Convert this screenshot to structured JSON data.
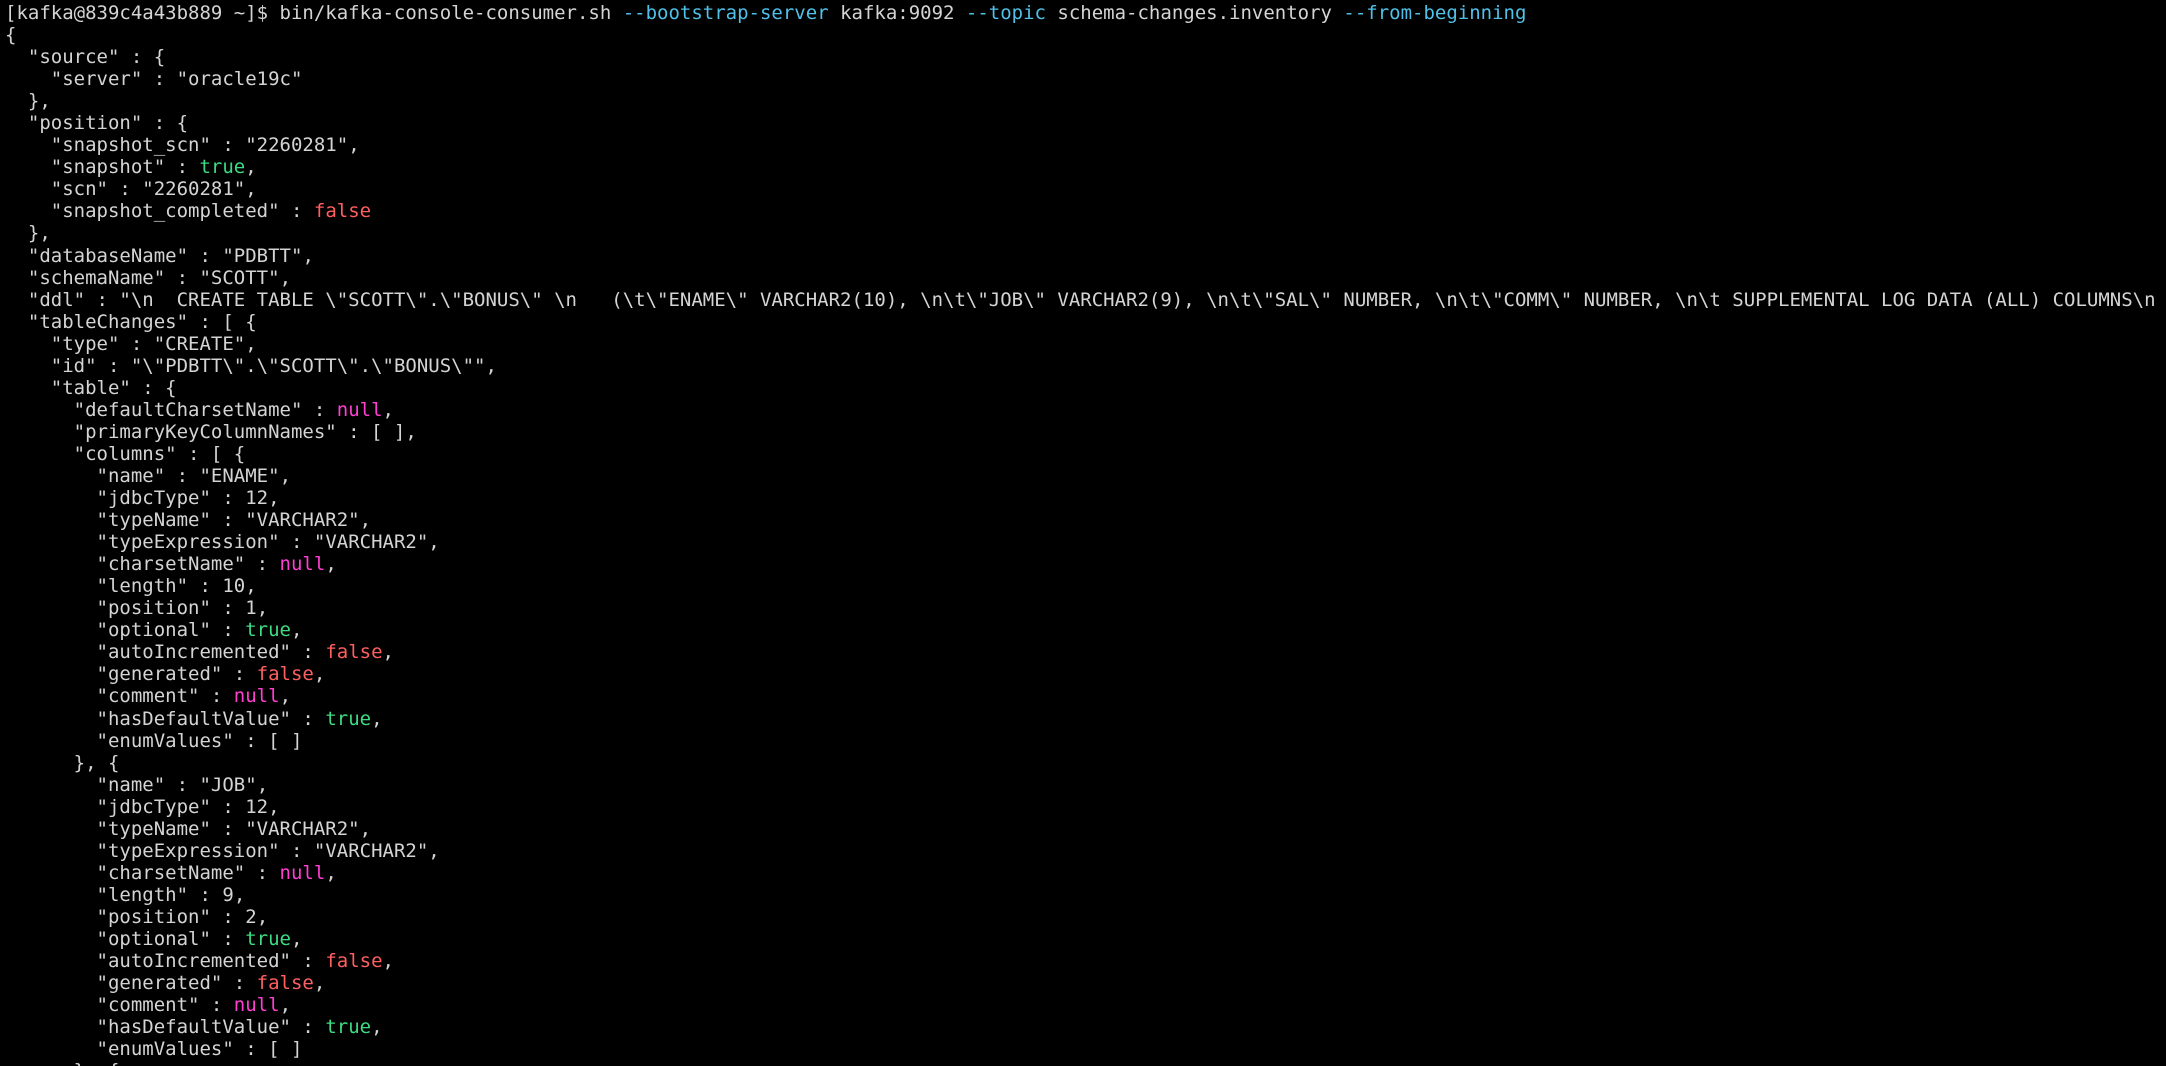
{
  "colors": {
    "background": "#000000",
    "text": "#d4d4d4",
    "flag": "#4fc1e9",
    "true": "#3ddc84",
    "false": "#ff5f5f",
    "null": "#ff3fd2"
  },
  "terminal": {
    "lines": [
      [
        [
          "prompt",
          "[kafka@839c4a43b889 ~]$ "
        ],
        [
          "cmd",
          "bin/kafka-console-consumer.sh "
        ],
        [
          "flag",
          "--bootstrap-server"
        ],
        [
          "arg",
          " kafka:9092 "
        ],
        [
          "flag",
          "--topic"
        ],
        [
          "arg",
          " schema-changes.inventory "
        ],
        [
          "flag",
          "--from-beginning"
        ]
      ],
      [
        [
          "punct",
          "{"
        ]
      ],
      [
        [
          "key",
          "  \"source\""
        ],
        [
          "punct",
          " : {"
        ]
      ],
      [
        [
          "key",
          "    \"server\""
        ],
        [
          "punct",
          " : "
        ],
        [
          "str",
          "\"oracle19c\""
        ]
      ],
      [
        [
          "punct",
          "  },"
        ]
      ],
      [
        [
          "key",
          "  \"position\""
        ],
        [
          "punct",
          " : {"
        ]
      ],
      [
        [
          "key",
          "    \"snapshot_scn\""
        ],
        [
          "punct",
          " : "
        ],
        [
          "str",
          "\"2260281\""
        ],
        [
          "punct",
          ","
        ]
      ],
      [
        [
          "key",
          "    \"snapshot\""
        ],
        [
          "punct",
          " : "
        ],
        [
          "true",
          "true"
        ],
        [
          "punct",
          ","
        ]
      ],
      [
        [
          "key",
          "    \"scn\""
        ],
        [
          "punct",
          " : "
        ],
        [
          "str",
          "\"2260281\""
        ],
        [
          "punct",
          ","
        ]
      ],
      [
        [
          "key",
          "    \"snapshot_completed\""
        ],
        [
          "punct",
          " : "
        ],
        [
          "false",
          "false"
        ]
      ],
      [
        [
          "punct",
          "  },"
        ]
      ],
      [
        [
          "key",
          "  \"databaseName\""
        ],
        [
          "punct",
          " : "
        ],
        [
          "str",
          "\"PDBTT\""
        ],
        [
          "punct",
          ","
        ]
      ],
      [
        [
          "key",
          "  \"schemaName\""
        ],
        [
          "punct",
          " : "
        ],
        [
          "str",
          "\"SCOTT\""
        ],
        [
          "punct",
          ","
        ]
      ],
      [
        [
          "key",
          "  \"ddl\""
        ],
        [
          "punct",
          " : "
        ],
        [
          "str",
          "\"\\n  CREATE TABLE \\\"SCOTT\\\".\\\"BONUS\\\" \\n   (\\t\\\"ENAME\\\" VARCHAR2(10), \\n\\t\\\"JOB\\\" VARCHAR2(9), \\n\\t\\\"SAL\\\" NUMBER, \\n\\t\\\"COMM\\\" NUMBER, \\n\\t SUPPLEMENTAL LOG DATA (ALL) COLUMNS\\n   ) ;\""
        ],
        [
          "punct",
          ","
        ]
      ],
      [
        [
          "key",
          "  \"tableChanges\""
        ],
        [
          "punct",
          " : [ {"
        ]
      ],
      [
        [
          "key",
          "    \"type\""
        ],
        [
          "punct",
          " : "
        ],
        [
          "str",
          "\"CREATE\""
        ],
        [
          "punct",
          ","
        ]
      ],
      [
        [
          "key",
          "    \"id\""
        ],
        [
          "punct",
          " : "
        ],
        [
          "str",
          "\"\\\"PDBTT\\\".\\\"SCOTT\\\".\\\"BONUS\\\"\""
        ],
        [
          "punct",
          ","
        ]
      ],
      [
        [
          "key",
          "    \"table\""
        ],
        [
          "punct",
          " : {"
        ]
      ],
      [
        [
          "key",
          "      \"defaultCharsetName\""
        ],
        [
          "punct",
          " : "
        ],
        [
          "null",
          "null"
        ],
        [
          "punct",
          ","
        ]
      ],
      [
        [
          "key",
          "      \"primaryKeyColumnNames\""
        ],
        [
          "punct",
          " : [ ],"
        ]
      ],
      [
        [
          "key",
          "      \"columns\""
        ],
        [
          "punct",
          " : [ {"
        ]
      ],
      [
        [
          "key",
          "        \"name\""
        ],
        [
          "punct",
          " : "
        ],
        [
          "str",
          "\"ENAME\""
        ],
        [
          "punct",
          ","
        ]
      ],
      [
        [
          "key",
          "        \"jdbcType\""
        ],
        [
          "punct",
          " : "
        ],
        [
          "num",
          "12"
        ],
        [
          "punct",
          ","
        ]
      ],
      [
        [
          "key",
          "        \"typeName\""
        ],
        [
          "punct",
          " : "
        ],
        [
          "str",
          "\"VARCHAR2\""
        ],
        [
          "punct",
          ","
        ]
      ],
      [
        [
          "key",
          "        \"typeExpression\""
        ],
        [
          "punct",
          " : "
        ],
        [
          "str",
          "\"VARCHAR2\""
        ],
        [
          "punct",
          ","
        ]
      ],
      [
        [
          "key",
          "        \"charsetName\""
        ],
        [
          "punct",
          " : "
        ],
        [
          "null",
          "null"
        ],
        [
          "punct",
          ","
        ]
      ],
      [
        [
          "key",
          "        \"length\""
        ],
        [
          "punct",
          " : "
        ],
        [
          "num",
          "10"
        ],
        [
          "punct",
          ","
        ]
      ],
      [
        [
          "key",
          "        \"position\""
        ],
        [
          "punct",
          " : "
        ],
        [
          "num",
          "1"
        ],
        [
          "punct",
          ","
        ]
      ],
      [
        [
          "key",
          "        \"optional\""
        ],
        [
          "punct",
          " : "
        ],
        [
          "true",
          "true"
        ],
        [
          "punct",
          ","
        ]
      ],
      [
        [
          "key",
          "        \"autoIncremented\""
        ],
        [
          "punct",
          " : "
        ],
        [
          "false",
          "false"
        ],
        [
          "punct",
          ","
        ]
      ],
      [
        [
          "key",
          "        \"generated\""
        ],
        [
          "punct",
          " : "
        ],
        [
          "false",
          "false"
        ],
        [
          "punct",
          ","
        ]
      ],
      [
        [
          "key",
          "        \"comment\""
        ],
        [
          "punct",
          " : "
        ],
        [
          "null",
          "null"
        ],
        [
          "punct",
          ","
        ]
      ],
      [
        [
          "key",
          "        \"hasDefaultValue\""
        ],
        [
          "punct",
          " : "
        ],
        [
          "true",
          "true"
        ],
        [
          "punct",
          ","
        ]
      ],
      [
        [
          "key",
          "        \"enumValues\""
        ],
        [
          "punct",
          " : [ ]"
        ]
      ],
      [
        [
          "punct",
          "      }, {"
        ]
      ],
      [
        [
          "key",
          "        \"name\""
        ],
        [
          "punct",
          " : "
        ],
        [
          "str",
          "\"JOB\""
        ],
        [
          "punct",
          ","
        ]
      ],
      [
        [
          "key",
          "        \"jdbcType\""
        ],
        [
          "punct",
          " : "
        ],
        [
          "num",
          "12"
        ],
        [
          "punct",
          ","
        ]
      ],
      [
        [
          "key",
          "        \"typeName\""
        ],
        [
          "punct",
          " : "
        ],
        [
          "str",
          "\"VARCHAR2\""
        ],
        [
          "punct",
          ","
        ]
      ],
      [
        [
          "key",
          "        \"typeExpression\""
        ],
        [
          "punct",
          " : "
        ],
        [
          "str",
          "\"VARCHAR2\""
        ],
        [
          "punct",
          ","
        ]
      ],
      [
        [
          "key",
          "        \"charsetName\""
        ],
        [
          "punct",
          " : "
        ],
        [
          "null",
          "null"
        ],
        [
          "punct",
          ","
        ]
      ],
      [
        [
          "key",
          "        \"length\""
        ],
        [
          "punct",
          " : "
        ],
        [
          "num",
          "9"
        ],
        [
          "punct",
          ","
        ]
      ],
      [
        [
          "key",
          "        \"position\""
        ],
        [
          "punct",
          " : "
        ],
        [
          "num",
          "2"
        ],
        [
          "punct",
          ","
        ]
      ],
      [
        [
          "key",
          "        \"optional\""
        ],
        [
          "punct",
          " : "
        ],
        [
          "true",
          "true"
        ],
        [
          "punct",
          ","
        ]
      ],
      [
        [
          "key",
          "        \"autoIncremented\""
        ],
        [
          "punct",
          " : "
        ],
        [
          "false",
          "false"
        ],
        [
          "punct",
          ","
        ]
      ],
      [
        [
          "key",
          "        \"generated\""
        ],
        [
          "punct",
          " : "
        ],
        [
          "false",
          "false"
        ],
        [
          "punct",
          ","
        ]
      ],
      [
        [
          "key",
          "        \"comment\""
        ],
        [
          "punct",
          " : "
        ],
        [
          "null",
          "null"
        ],
        [
          "punct",
          ","
        ]
      ],
      [
        [
          "key",
          "        \"hasDefaultValue\""
        ],
        [
          "punct",
          " : "
        ],
        [
          "true",
          "true"
        ],
        [
          "punct",
          ","
        ]
      ],
      [
        [
          "key",
          "        \"enumValues\""
        ],
        [
          "punct",
          " : [ ]"
        ]
      ],
      [
        [
          "punct",
          "      }, {"
        ]
      ]
    ]
  }
}
